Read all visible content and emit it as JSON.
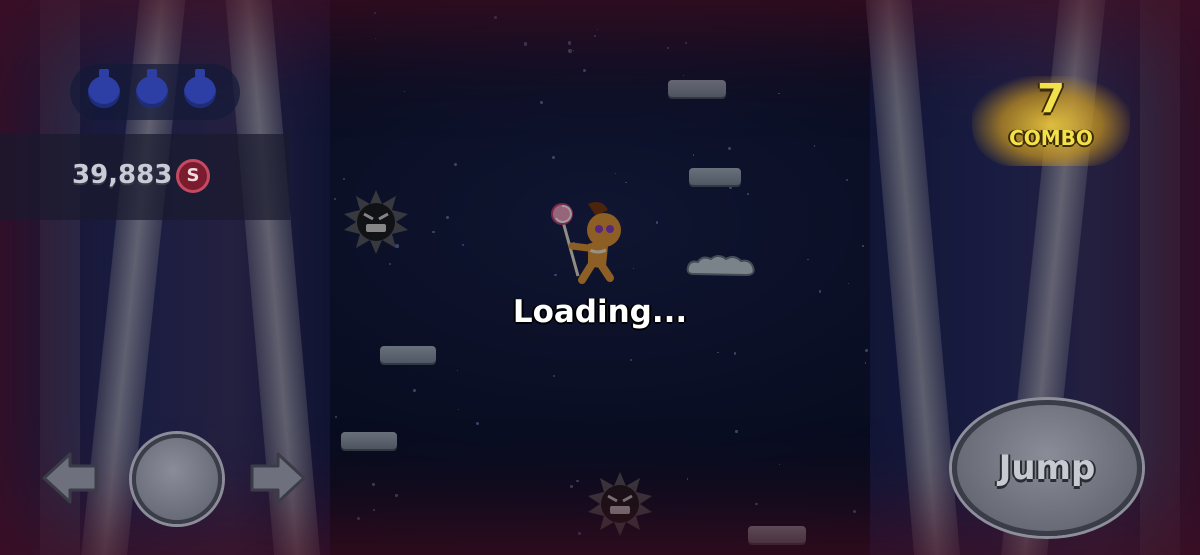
{
  "hud": {
    "coins": "39,883",
    "coin_symbol": "S",
    "potions_icon": "potion-icon",
    "potion_count_visible": 3
  },
  "combo": {
    "number": "7",
    "label": "COMBO"
  },
  "status": {
    "loading_text": "Loading..."
  },
  "controls": {
    "left_icon": "arrow-left-icon",
    "right_icon": "arrow-right-icon",
    "jump_label": "Jump"
  },
  "colors": {
    "sky": "#0e1433",
    "combo_gold": "#f3e14b",
    "coin_red": "#7b1b2e",
    "platform": "#a9b7c8"
  }
}
